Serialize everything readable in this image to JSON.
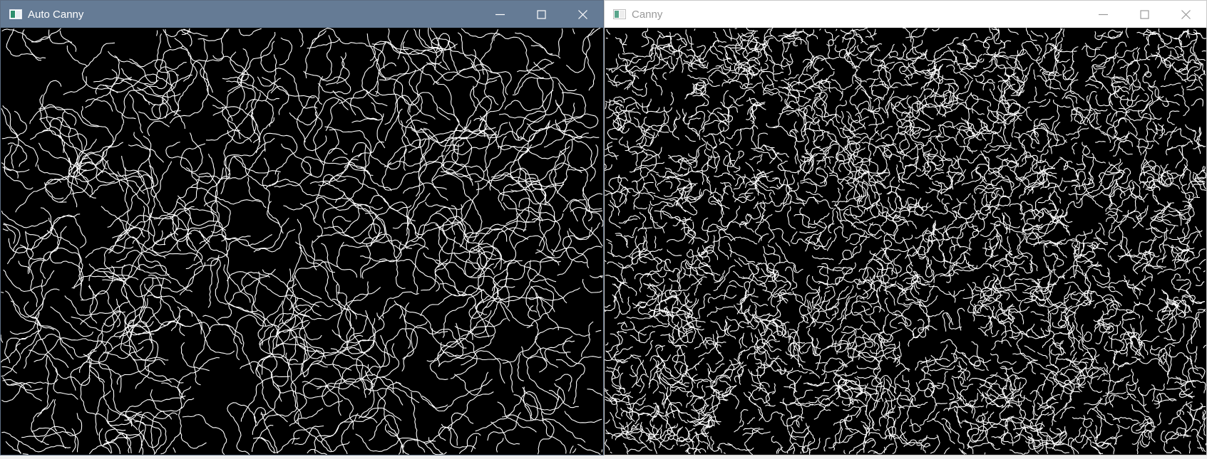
{
  "colors": {
    "active_titlebar": "#657b95",
    "inactive_titlebar": "#ffffff",
    "edge_color": "#ffffff",
    "canvas_background": "#000000"
  },
  "windows": [
    {
      "title": "Auto Canny",
      "state": "active",
      "icons": [
        "app-icon",
        "minimize-icon",
        "maximize-icon",
        "close-icon"
      ],
      "content": "edge-map",
      "edge_density": "sparse"
    },
    {
      "title": "Canny",
      "state": "inactive",
      "icons": [
        "app-icon",
        "minimize-icon",
        "maximize-icon",
        "close-icon"
      ],
      "content": "edge-map",
      "edge_density": "dense"
    }
  ]
}
